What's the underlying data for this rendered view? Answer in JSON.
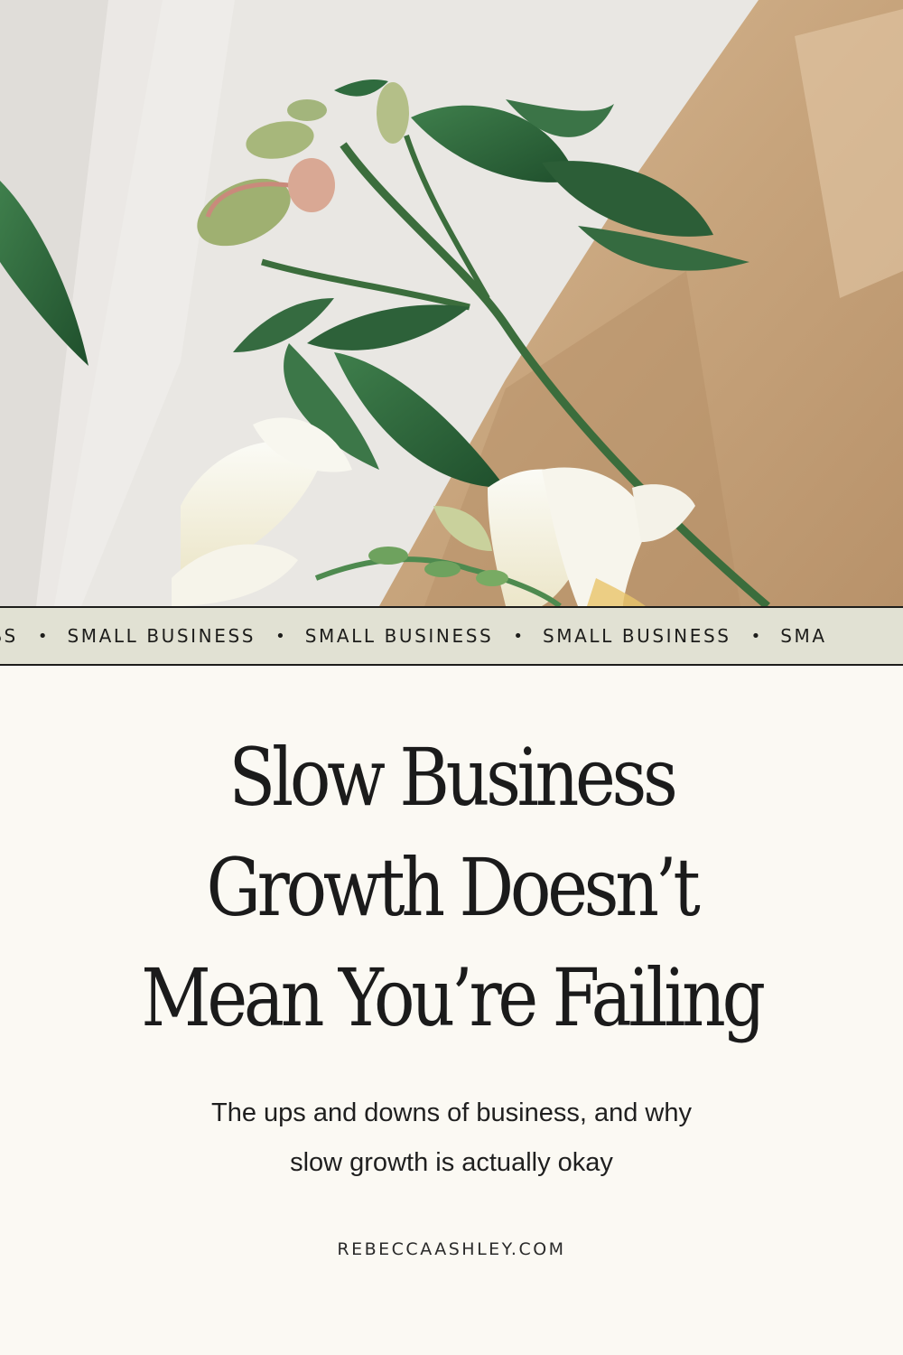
{
  "ticker": {
    "items": [
      "ESS",
      "SMALL BUSINESS",
      "SMALL BUSINESS",
      "SMALL BUSINESS",
      "SMA"
    ],
    "separator": "•"
  },
  "headline": {
    "lines": [
      "Slow Business",
      "Growth Doesn’t",
      "Mean You’re Failing"
    ]
  },
  "subtitle": {
    "lines": [
      "The ups and downs of business, and why",
      "slow growth is actually okay"
    ]
  },
  "website": "REBECCAASHLEY.COM",
  "colors": {
    "background": "#fbf9f3",
    "ticker_band": "#e1e1d3",
    "text": "#1b1b1b",
    "leaf": "#2f6b3e",
    "kraft_paper": "#c9a77f"
  }
}
